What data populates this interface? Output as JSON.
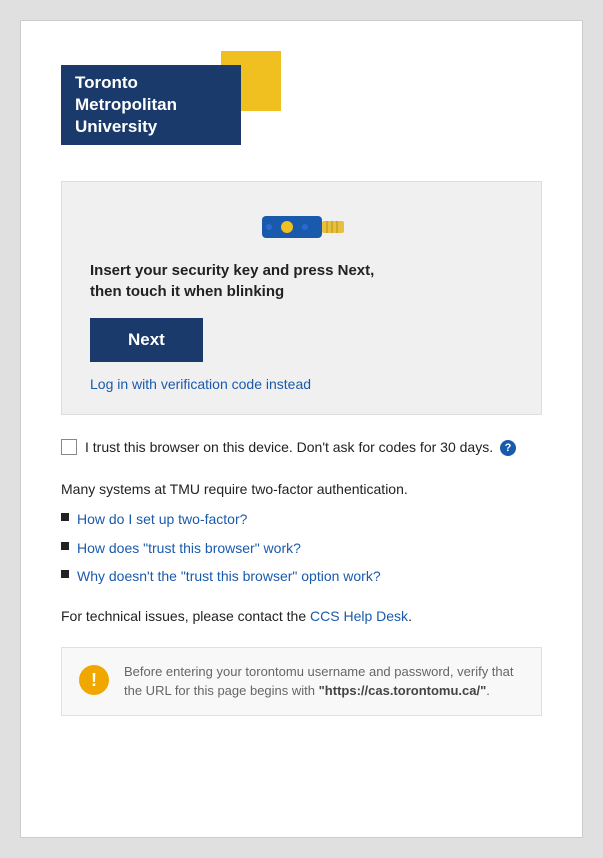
{
  "logo": {
    "line1": "Toronto",
    "line2": "Metropolitan",
    "line3": "University"
  },
  "auth_box": {
    "instruction": "Insert your security key and press Next,\nthen touch it when blinking",
    "next_button_label": "Next",
    "verification_link": "Log in with verification code instead"
  },
  "trust_section": {
    "label": "I trust this browser on this device. Don't ask for codes for 30 days.",
    "help_tooltip": "?"
  },
  "info_section": {
    "intro": "Many systems at TMU require two-factor authentication.",
    "links": [
      "How do I set up two-factor?",
      "How does \"trust this browser\" work?",
      "Why doesn't the \"trust this browser\" option work?"
    ],
    "technical": "For technical issues, please contact the ",
    "ccs_link": "CCS Help Desk",
    "technical_end": "."
  },
  "warning": {
    "text_prefix": "Before entering your torontomu username and password, verify that the URL for this page begins with ",
    "text_bold": "\"https://cas.torontomu.ca/\"",
    "text_suffix": "."
  }
}
